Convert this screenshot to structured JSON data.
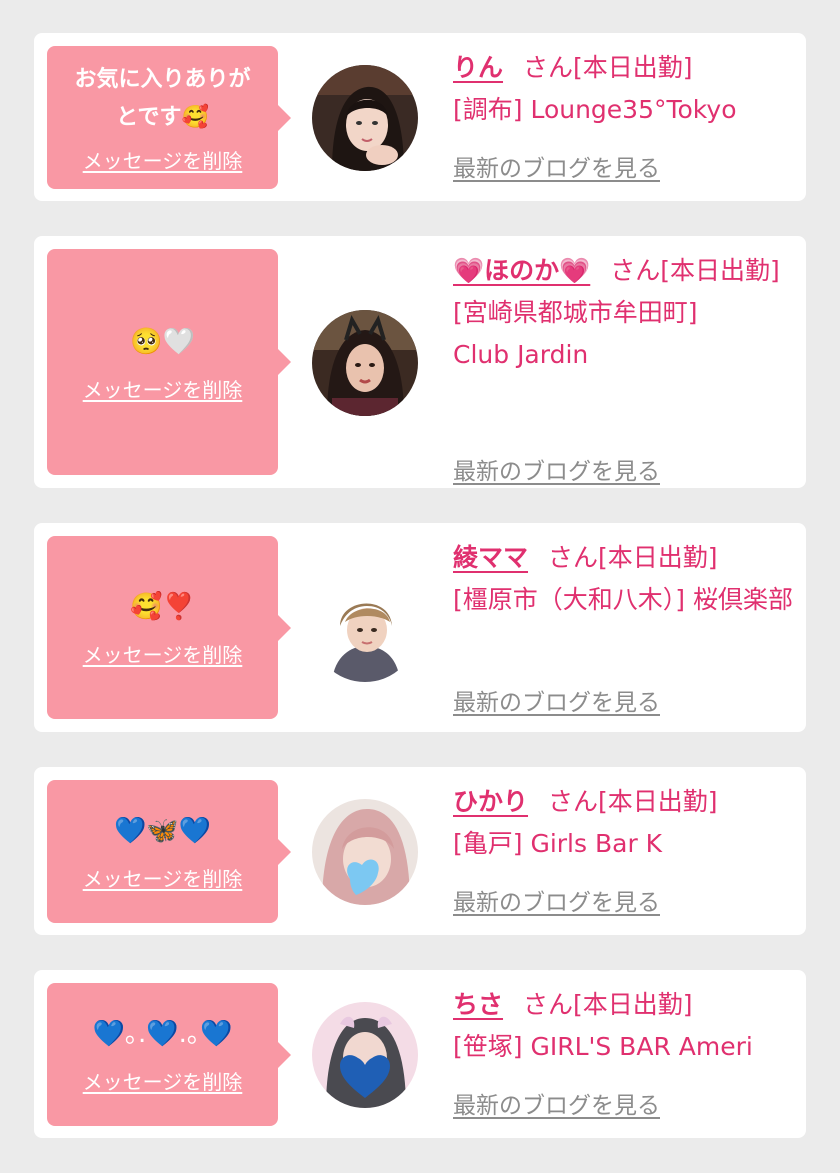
{
  "cards": [
    {
      "message": "お気に入りありが\nとです🥰",
      "delete_label": "メッセージを削除",
      "cast_name": "りん",
      "status": "さん[本日出勤]",
      "shop": "[調布] Lounge35°Tokyo",
      "blog_label": "最新のブログを見る"
    },
    {
      "message": "🥺🤍",
      "delete_label": "メッセージを削除",
      "cast_name": "💗ほのか💗",
      "status": "さん[本日出勤]",
      "shop": "[宮崎県都城市牟田町] Club Jardin",
      "blog_label": "最新のブログを見る"
    },
    {
      "message": "🥰❣️",
      "delete_label": "メッセージを削除",
      "cast_name": "綾ママ",
      "status": "さん[本日出勤]",
      "shop": "[橿原市（大和八木）] 桜倶楽部",
      "blog_label": "最新のブログを見る"
    },
    {
      "message": "💙🦋💙",
      "delete_label": "メッセージを削除",
      "cast_name": "ひかり",
      "status": "さん[本日出勤]",
      "shop": "[亀戸] Girls Bar K",
      "blog_label": "最新のブログを見る"
    },
    {
      "message": "💙｡.💙.｡💙",
      "delete_label": "メッセージを削除",
      "cast_name": "ちさ",
      "status": "さん[本日出勤]",
      "shop": "[笹塚] GIRL'S BAR Ameri",
      "blog_label": "最新のブログを見る"
    }
  ],
  "colors": {
    "background": "#ebebeb",
    "bubble": "#f998a4",
    "accent": "#e0306f",
    "blog_link": "#8c8c8c"
  }
}
